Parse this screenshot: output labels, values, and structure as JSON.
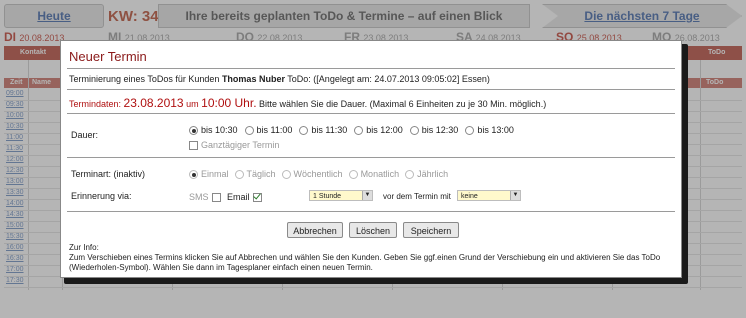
{
  "topbar": {
    "today": "Heute",
    "kw": "KW: 34",
    "banner": "Ihre bereits geplanten ToDo & Termine – auf einen Blick",
    "next7": "Die nächsten 7 Tage"
  },
  "days": [
    {
      "name": "DI",
      "date": "20.08.2013"
    },
    {
      "name": "MI",
      "date": "21.08.2013"
    },
    {
      "name": "DO",
      "date": "22.08.2013"
    },
    {
      "name": "FR",
      "date": "23.08.2013"
    },
    {
      "name": "SA",
      "date": "24.08.2013"
    },
    {
      "name": "SO",
      "date": "25.08.2013"
    },
    {
      "name": "MO",
      "date": "26.08.2013"
    }
  ],
  "grid": {
    "kontakt": "Kontakt",
    "todo": "ToDo",
    "todo2": "ToDo",
    "zeit": "Zeit",
    "name": "Name",
    "times": [
      "09:00",
      "09:30",
      "10:00",
      "10:30",
      "11:00",
      "11:30",
      "12:00",
      "12:30",
      "13:00",
      "13:30",
      "14:00",
      "14:30",
      "15:00",
      "15:30",
      "16:00",
      "16:30",
      "17:00",
      "17:30"
    ]
  },
  "dialog": {
    "title": "Neuer Termin",
    "line1_prefix": "Terminierung eines ToDos für Kunden",
    "customer": "Thomas Nuber",
    "line1_suffix": "ToDo: ([Angelegt am: 24.07.2013 09:05:02] Essen)",
    "termindaten_label": "Termindaten:",
    "date": "23.08.2013",
    "um": "um",
    "time": "10:00 Uhr.",
    "duration_hint": "Bitte wählen Sie die Dauer. (Maximal 6 Einheiten zu je 30 Min. möglich.)",
    "dauer_label": "Dauer:",
    "durations": [
      "bis 10:30",
      "bis 11:00",
      "bis 11:30",
      "bis 12:00",
      "bis 12:30",
      "bis 13:00"
    ],
    "ganztaegig": "Ganztägiger Termin",
    "terminart_label": "Terminart: (inaktiv)",
    "terminarten": [
      "Einmal",
      "Täglich",
      "Wöchentlich",
      "Monatlich",
      "Jährlich"
    ],
    "erinnerung_label": "Erinnerung via:",
    "sms": "SMS",
    "email": "Email",
    "reminder_value": "1 Stunde",
    "vor_text": "vor dem Termin mit",
    "reminder_with": "keine",
    "btn_cancel": "Abbrechen",
    "btn_delete": "Löschen",
    "btn_save": "Speichern",
    "info_head": "Zur Info:",
    "info_text": "Zum Verschieben eines Termins klicken Sie auf Abbrechen und wählen Sie den Kunden. Geben Sie ggf.einen Grund der Verschiebung ein und aktivieren Sie das ToDo (Wiederholen-Symbol). Wählen Sie dann im Tagesplaner einfach einen neuen Termin."
  }
}
